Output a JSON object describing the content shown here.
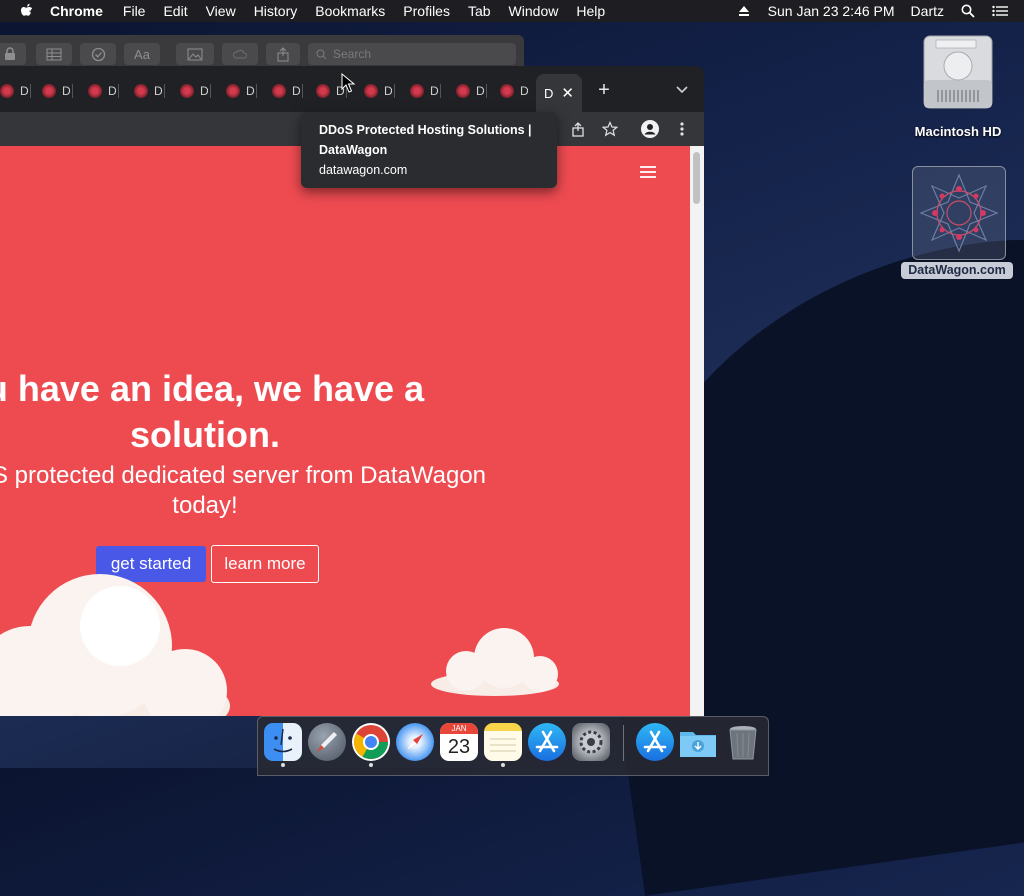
{
  "menubar": {
    "app_name": "Chrome",
    "items": [
      "File",
      "Edit",
      "View",
      "History",
      "Bookmarks",
      "Profiles",
      "Tab",
      "Window",
      "Help"
    ],
    "datetime": "Sun Jan 23  2:46 PM",
    "user": "Dartz"
  },
  "back_window": {
    "search_placeholder": "Search",
    "format_label": "Aa"
  },
  "browser": {
    "background_tab_title": "D",
    "active_tab_title": "D",
    "close_tab_glyph": "✕",
    "new_tab_glyph": "+",
    "tooltip": {
      "title": "DDoS Protected Hosting Solutions | DataWagon",
      "url": "datawagon.com"
    }
  },
  "page": {
    "headline": "u have an idea, we have a solution.",
    "subline": "a DDoS protected dedicated server from DataWagon today!",
    "primary_button": "get started",
    "secondary_button": "learn more",
    "accent_color": "#ee4b51",
    "button_color": "#4a58e8"
  },
  "desktop": {
    "drive_label": "Macintosh HD",
    "file_label": "DataWagon.com"
  },
  "dock": {
    "apps": [
      "Finder",
      "Launchpad",
      "Google Chrome",
      "Safari",
      "Calendar",
      "Notes",
      "App Store",
      "System Preferences",
      "App Store",
      "Downloads",
      "Trash"
    ],
    "calendar_month": "JAN",
    "calendar_day": "23"
  }
}
